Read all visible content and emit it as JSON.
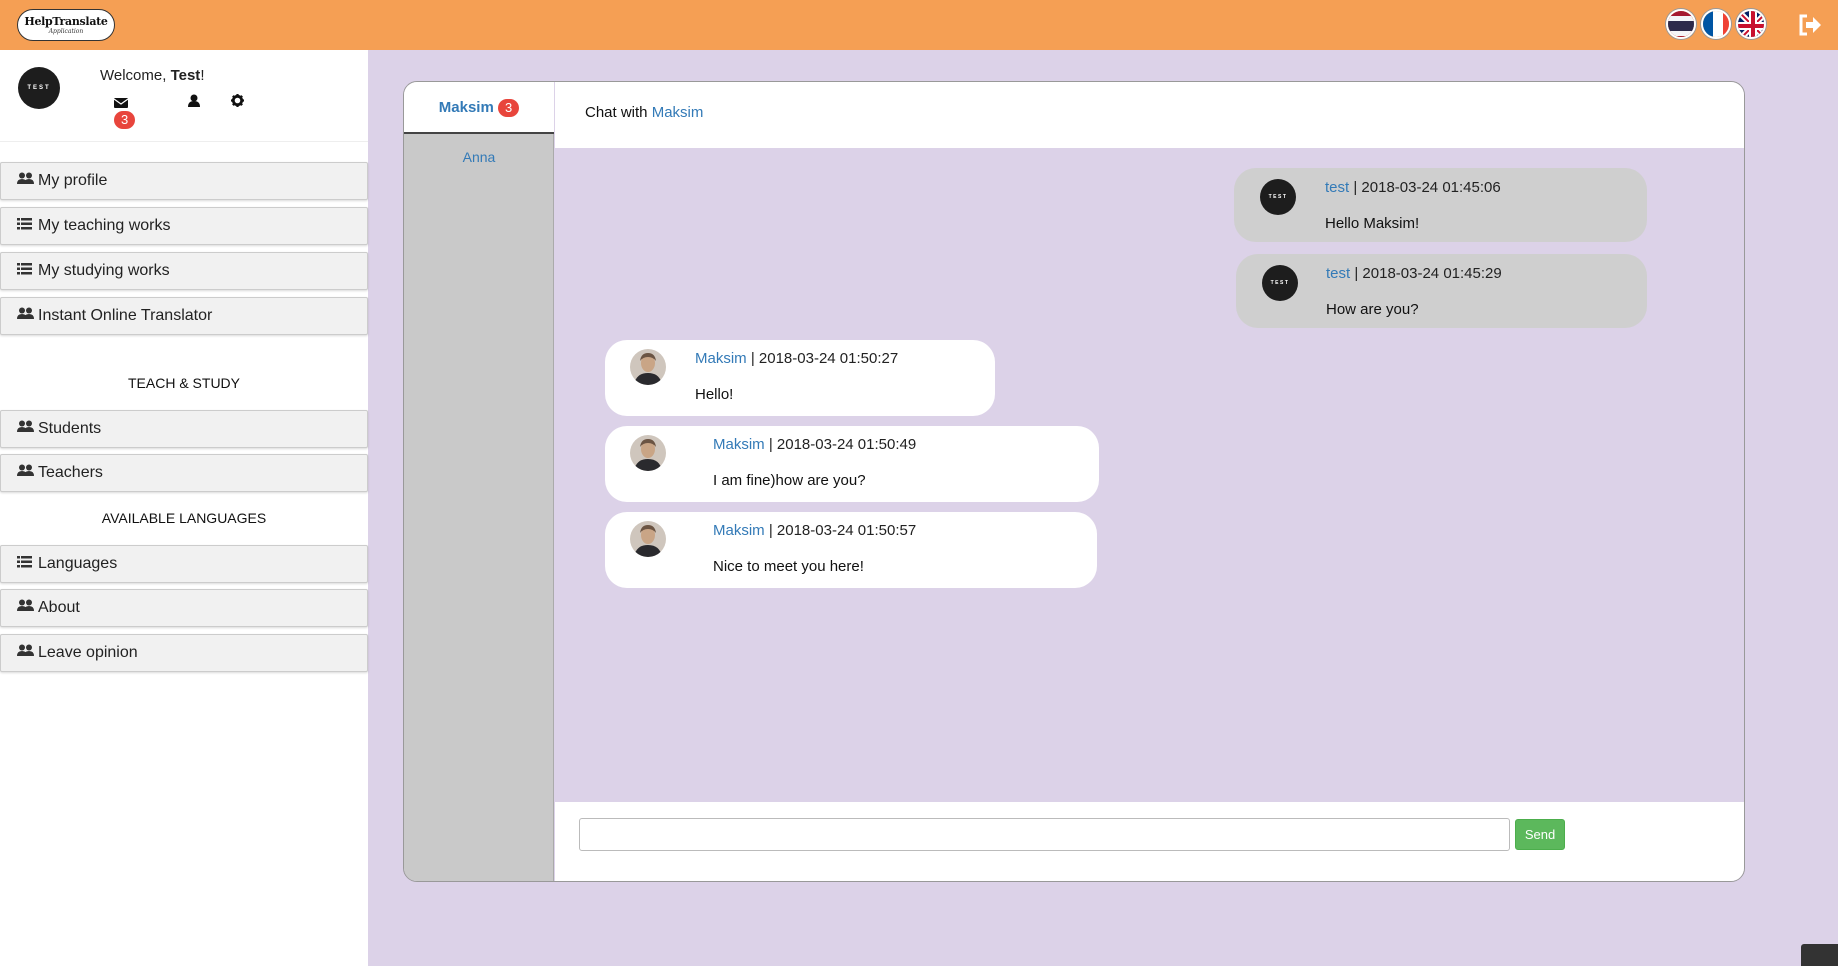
{
  "app": {
    "logo_line1": "HelpTranslate",
    "logo_line2": "Application",
    "accent_color": "#f59f54",
    "background_color": "#dcd2e8"
  },
  "topbar": {
    "flags": [
      {
        "name": "thailand-flag-icon"
      },
      {
        "name": "france-flag-icon"
      },
      {
        "name": "uk-flag-icon"
      }
    ],
    "logout_icon": "sign-out-icon"
  },
  "user": {
    "avatar_text": "TEST",
    "welcome_prefix": "Welcome, ",
    "name": "Test",
    "welcome_suffix": "!",
    "unread_count": "3"
  },
  "menu": {
    "items": [
      {
        "label": "My profile",
        "icon": "users-icon"
      },
      {
        "label": "My teaching works",
        "icon": "list-icon"
      },
      {
        "label": "My studying works",
        "icon": "list-icon"
      },
      {
        "label": "Instant Online Translator",
        "icon": "users-icon"
      }
    ],
    "teach_title": "TEACH & STUDY",
    "teach_items": [
      {
        "label": "Students",
        "icon": "users-icon"
      },
      {
        "label": "Teachers",
        "icon": "users-icon"
      }
    ],
    "languages_title": "AVAILABLE LANGUAGES",
    "language_items": [
      {
        "label": "Languages",
        "icon": "list-icon"
      },
      {
        "label": "About",
        "icon": "users-icon"
      },
      {
        "label": "Leave opinion",
        "icon": "users-icon"
      }
    ]
  },
  "chat": {
    "contacts": [
      {
        "name": "Maksim",
        "unread": "3"
      },
      {
        "name": "Anna"
      }
    ],
    "title_prefix": "Chat with ",
    "title_name": "Maksim",
    "messages": [
      {
        "author": "test",
        "time": " | 2018-03-24 01:45:06",
        "text": "Hello Maksim!"
      },
      {
        "author": "test",
        "time": " | 2018-03-24 01:45:29",
        "text": "How are you?"
      },
      {
        "author": "Maksim",
        "time": " | 2018-03-24 01:50:27",
        "text": "Hello!"
      },
      {
        "author": "Maksim",
        "time": " | 2018-03-24 01:50:49",
        "text": "I am fine)how are you?"
      },
      {
        "author": "Maksim",
        "time": " | 2018-03-24 01:50:57",
        "text": "Nice to meet you here!"
      }
    ],
    "input_value": "",
    "input_placeholder": "",
    "send_label": "Send"
  }
}
